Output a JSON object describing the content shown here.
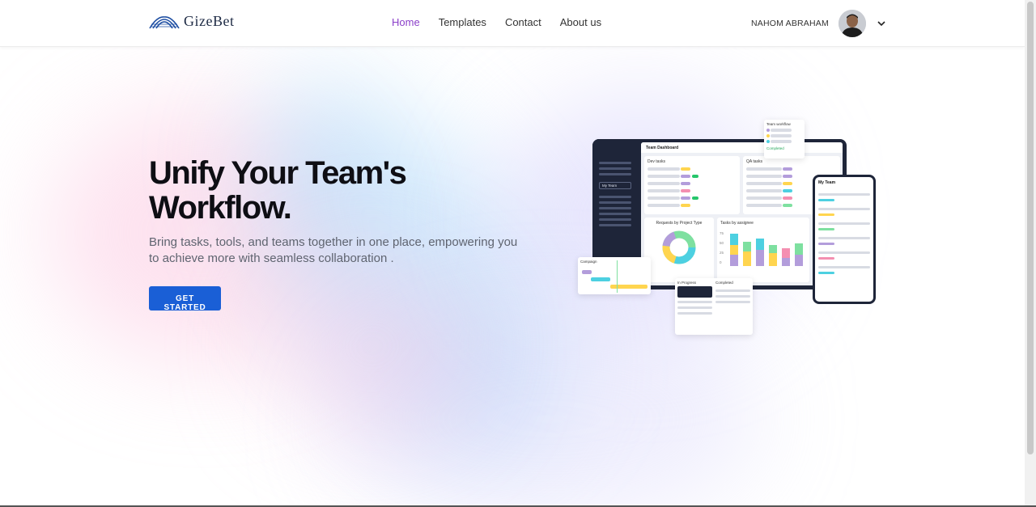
{
  "brand": {
    "name": "GizeBet",
    "logo_icon": "wave-stripes-logo"
  },
  "nav": {
    "items": [
      {
        "label": "Home",
        "active": true
      },
      {
        "label": "Templates",
        "active": false
      },
      {
        "label": "Contact",
        "active": false
      },
      {
        "label": "About us",
        "active": false
      }
    ],
    "active_color": "#8b3fc9"
  },
  "user": {
    "name": "NAHOM ABRAHAM",
    "menu_icon": "chevron-down-icon"
  },
  "hero": {
    "title_line1": "Unify Your Team's",
    "title_line2": "Workflow.",
    "subtitle": "Bring tasks, tools, and teams together in one place, empowering you to achieve more with seamless collaboration .",
    "cta_label": "GET STARTED",
    "cta_color": "#1a5fd6"
  },
  "illustration": {
    "dashboard_title": "Team Dashboard",
    "sidebar_team": "My Team",
    "dev_tasks": "Dev tasks",
    "qa_tasks": "QA tasks",
    "requests_chart": "Requests by Project Type",
    "assignee_chart": "Tasks by assignee",
    "assignee_ticks": [
      "75",
      "50",
      "25",
      "0"
    ],
    "workflow_card": "Team workflow",
    "workflow_status": "Completed",
    "campaign_card": "Campaign",
    "in_progress": "In Progress",
    "completed": "Completed",
    "phone_title": "My Team"
  }
}
